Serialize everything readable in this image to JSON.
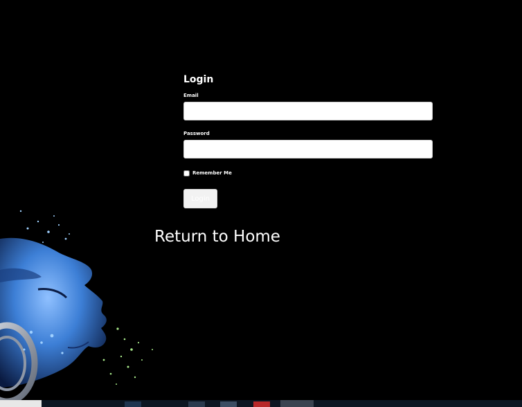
{
  "login": {
    "title": "Login",
    "email_label": "Email",
    "email_value": "",
    "password_label": "Password",
    "password_value": "",
    "remember_label": "Remember Me",
    "remember_checked": false,
    "submit_label": "Login"
  },
  "return_link": "Return to Home",
  "colors": {
    "background": "#000000",
    "text": "#ffffff",
    "face_blue": "#3d7fd6"
  },
  "taskbar": {
    "icons": [
      "windows-start-icon",
      "app-icon",
      "app-icon",
      "app-icon",
      "app-icon",
      "app-icon"
    ]
  }
}
